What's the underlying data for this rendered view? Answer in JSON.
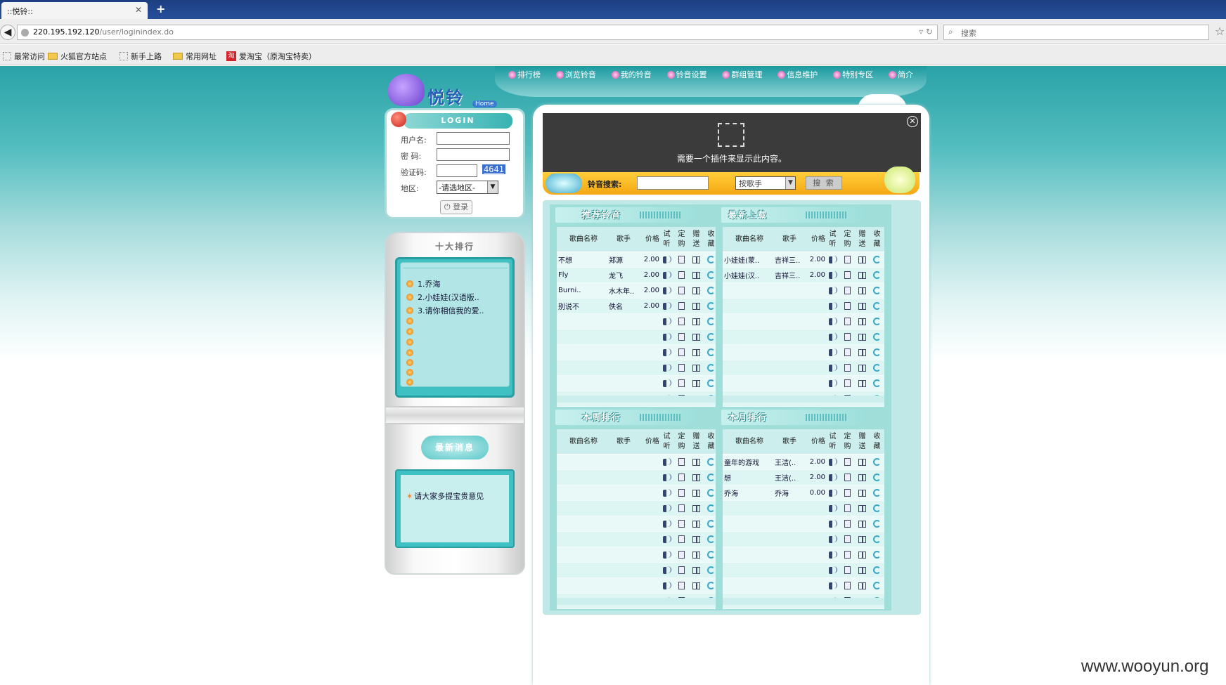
{
  "browser": {
    "tab_title": "::悦铃::",
    "new_tab": "+",
    "url_host": "220.195.192.120",
    "url_path": "/user/loginindex.do",
    "search_placeholder": "搜索",
    "bookmarks": [
      "最常访问",
      "火狐官方站点",
      "新手上路",
      "常用网址",
      "爱淘宝（原淘宝特卖）"
    ]
  },
  "site": {
    "logo_text": "悦铃",
    "logo_sub": "Home",
    "nav": [
      "排行榜",
      "浏览铃音",
      "我的铃音",
      "铃音设置",
      "群组管理",
      "信息维护",
      "特别专区",
      "简介"
    ]
  },
  "login": {
    "header": "LOGIN",
    "username_label": "用户名:",
    "password_label": "密 码:",
    "captcha_label": "验证码:",
    "captcha_value": "4641",
    "region_label": "地区:",
    "region_value": "-请选地区-",
    "button": "登录"
  },
  "top10": {
    "title": "十大排行",
    "items": [
      "1.乔海",
      "2.小娃娃(汉语版..",
      "3.请你相信我的爱..",
      "",
      "",
      "",
      "",
      "",
      "",
      ""
    ]
  },
  "news": {
    "title": "最新消息",
    "items": [
      "请大家多提宝贵意见"
    ]
  },
  "plugin": {
    "message": "需要一个插件来显示此内容。"
  },
  "search": {
    "label": "铃音搜索:",
    "type_value": "按歌手",
    "button": "搜 索"
  },
  "table_headers": {
    "name": "歌曲名称",
    "singer": "歌手",
    "price": "价格",
    "listen": "试听",
    "order": "定购",
    "gift": "赠送",
    "fav": "收藏"
  },
  "panels": [
    {
      "title": "推荐铃音",
      "rows": [
        {
          "name": "不想",
          "singer": "郑源",
          "price": "2.00"
        },
        {
          "name": "Fly",
          "singer": "龙飞",
          "price": "2.00"
        },
        {
          "name": "Burni..",
          "singer": "水木年..",
          "price": "2.00"
        },
        {
          "name": "别说不",
          "singer": "佚名",
          "price": "2.00"
        },
        {
          "name": "",
          "singer": "",
          "price": ""
        },
        {
          "name": "",
          "singer": "",
          "price": ""
        },
        {
          "name": "",
          "singer": "",
          "price": ""
        },
        {
          "name": "",
          "singer": "",
          "price": ""
        },
        {
          "name": "",
          "singer": "",
          "price": ""
        },
        {
          "name": "",
          "singer": "",
          "price": ""
        }
      ]
    },
    {
      "title": "最新上载",
      "rows": [
        {
          "name": "小娃娃(蒙..",
          "singer": "吉祥三..",
          "price": "2.00"
        },
        {
          "name": "小娃娃(汉..",
          "singer": "吉祥三..",
          "price": "2.00"
        },
        {
          "name": "",
          "singer": "",
          "price": ""
        },
        {
          "name": "",
          "singer": "",
          "price": ""
        },
        {
          "name": "",
          "singer": "",
          "price": ""
        },
        {
          "name": "",
          "singer": "",
          "price": ""
        },
        {
          "name": "",
          "singer": "",
          "price": ""
        },
        {
          "name": "",
          "singer": "",
          "price": ""
        },
        {
          "name": "",
          "singer": "",
          "price": ""
        },
        {
          "name": "",
          "singer": "",
          "price": ""
        }
      ]
    },
    {
      "title": "本周排行",
      "rows": [
        {
          "name": "",
          "singer": "",
          "price": ""
        },
        {
          "name": "",
          "singer": "",
          "price": ""
        },
        {
          "name": "",
          "singer": "",
          "price": ""
        },
        {
          "name": "",
          "singer": "",
          "price": ""
        },
        {
          "name": "",
          "singer": "",
          "price": ""
        },
        {
          "name": "",
          "singer": "",
          "price": ""
        },
        {
          "name": "",
          "singer": "",
          "price": ""
        },
        {
          "name": "",
          "singer": "",
          "price": ""
        },
        {
          "name": "",
          "singer": "",
          "price": ""
        },
        {
          "name": "",
          "singer": "",
          "price": ""
        }
      ]
    },
    {
      "title": "本月排行",
      "rows": [
        {
          "name": "童年的游戏",
          "singer": "王洁(..",
          "price": "2.00"
        },
        {
          "name": "想",
          "singer": "王洁(..",
          "price": "2.00"
        },
        {
          "name": "乔海",
          "singer": "乔海",
          "price": "0.00"
        },
        {
          "name": "",
          "singer": "",
          "price": ""
        },
        {
          "name": "",
          "singer": "",
          "price": ""
        },
        {
          "name": "",
          "singer": "",
          "price": ""
        },
        {
          "name": "",
          "singer": "",
          "price": ""
        },
        {
          "name": "",
          "singer": "",
          "price": ""
        },
        {
          "name": "",
          "singer": "",
          "price": ""
        },
        {
          "name": "",
          "singer": "",
          "price": ""
        }
      ]
    }
  ],
  "watermark": "www.wooyun.org"
}
